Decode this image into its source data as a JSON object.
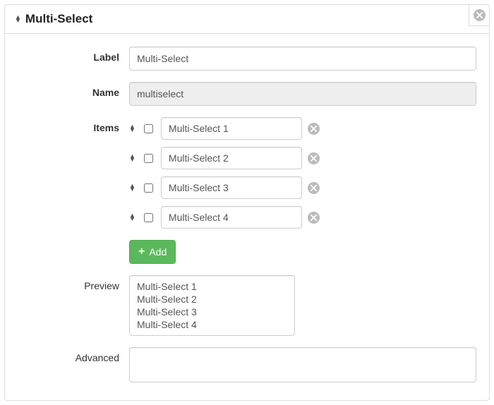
{
  "header": {
    "title": "Multi-Select"
  },
  "labels": {
    "label": "Label",
    "name": "Name",
    "items": "Items",
    "preview": "Preview",
    "advanced": "Advanced",
    "add": "Add"
  },
  "fields": {
    "label_value": "Multi-Select",
    "name_value": "multiselect",
    "advanced_value": ""
  },
  "items": [
    {
      "value": "Multi-Select 1",
      "checked": false
    },
    {
      "value": "Multi-Select 2",
      "checked": false
    },
    {
      "value": "Multi-Select 3",
      "checked": false
    },
    {
      "value": "Multi-Select 4",
      "checked": false
    }
  ],
  "preview": [
    "Multi-Select 1",
    "Multi-Select 2",
    "Multi-Select 3",
    "Multi-Select 4"
  ]
}
